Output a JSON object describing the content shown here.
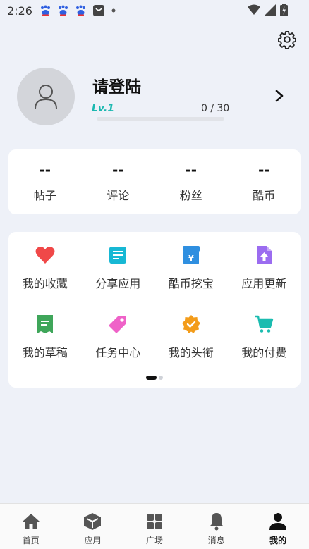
{
  "status_bar": {
    "time": "2:26",
    "notification_icons": [
      "baidu-paw-icon",
      "baidu-paw-icon",
      "baidu-paw-icon",
      "shopping-bag-icon",
      "dot-icon"
    ],
    "system_icons": [
      "wifi-icon",
      "signal-icon",
      "battery-charging-icon"
    ]
  },
  "profile": {
    "username": "请登陆",
    "level": "Lv.1",
    "exp_text": "0 / 30",
    "exp_progress": 0
  },
  "stats": [
    {
      "value": "--",
      "label": "帖子"
    },
    {
      "value": "--",
      "label": "评论"
    },
    {
      "value": "--",
      "label": "粉丝"
    },
    {
      "value": "--",
      "label": "酷币"
    }
  ],
  "features": [
    {
      "label": "我的收藏",
      "icon": "heart-icon",
      "color": "#f04848"
    },
    {
      "label": "分享应用",
      "icon": "share-app-icon",
      "color": "#17b8d4"
    },
    {
      "label": "酷币挖宝",
      "icon": "coin-treasure-icon",
      "color": "#2f8fe0"
    },
    {
      "label": "应用更新",
      "icon": "update-icon",
      "color": "#9b6cf0"
    },
    {
      "label": "我的草稿",
      "icon": "draft-icon",
      "color": "#3fa65a"
    },
    {
      "label": "任务中心",
      "icon": "task-tag-icon",
      "color": "#ef62c8"
    },
    {
      "label": "我的头衔",
      "icon": "badge-check-icon",
      "color": "#f39c1a"
    },
    {
      "label": "我的付费",
      "icon": "cart-icon",
      "color": "#1bbcb0"
    }
  ],
  "pager": {
    "pages": 2,
    "current": 1
  },
  "nav": [
    {
      "label": "首页",
      "icon": "home-icon"
    },
    {
      "label": "应用",
      "icon": "cube-icon"
    },
    {
      "label": "广场",
      "icon": "grid-icon"
    },
    {
      "label": "消息",
      "icon": "bell-icon"
    },
    {
      "label": "我的",
      "icon": "person-icon",
      "active": true
    }
  ],
  "colors": {
    "accent": "#1bb8b0",
    "background": "#eef1f8"
  }
}
